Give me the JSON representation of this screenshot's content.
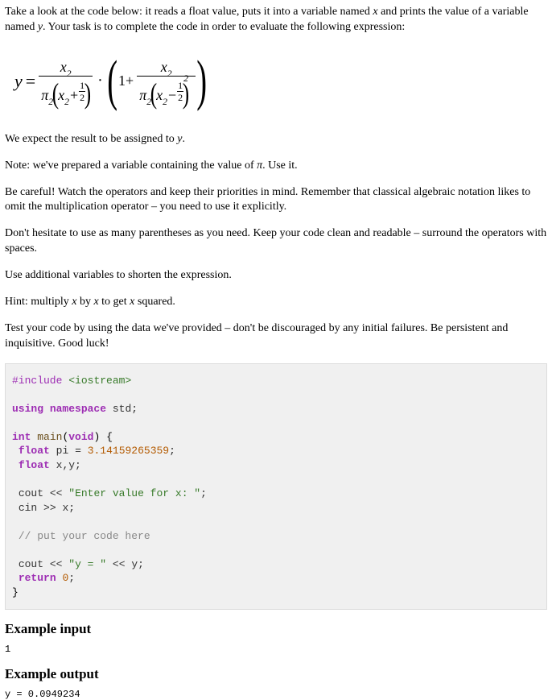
{
  "intro": "Take a look at the code below: it reads a float value, puts it into a variable named ",
  "intro2": " and prints the value of a variable named ",
  "intro3": ". Your task is to complete the code in order to evaluate the following expression:",
  "var_x": "x",
  "var_y": "y",
  "var_pi": "π",
  "expect": "We expect the result to be assigned to ",
  "expect_end": ".",
  "note": "Note: we've prepared a variable containing the value of ",
  "note_end": ". Use it.",
  "careful": "Be careful! Watch the operators and keep their priorities in mind. Remember that classical algebraic notation likes to omit the multiplication operator – you need to use it explicitly.",
  "parens": "Don't hesitate to use as many parentheses as you need. Keep your code clean and readable – surround the operators with spaces.",
  "additional": "Use additional variables to shorten the expression.",
  "hint_a": "Hint: multiply ",
  "hint_b": " by ",
  "hint_c": " to get ",
  "hint_d": " squared.",
  "test": "Test your code by using the data we've provided – don't be discouraged by any initial failures. Be persistent and inquisitive. Good luck!",
  "code": {
    "include": "#include",
    "iostream": "<iostream>",
    "using": "using",
    "namespace": "namespace",
    "std": "std",
    "int": "int",
    "main": "main",
    "void": "void",
    "float": "float",
    "pi": "pi",
    "eq": "=",
    "pival": "3.14159265359",
    "xy": "x,y",
    "cout": "cout",
    "ltlt": "<<",
    "prompt": "\"Enter value for x: \"",
    "cin": "cin",
    "gtgt": ">>",
    "x": "x",
    "comment": "// put your code here",
    "ystr": "\"y = \"",
    "y": "y",
    "return": "return",
    "zero": "0",
    "semi": ";"
  },
  "example_input_h": "Example input",
  "example_input": "1",
  "example_output_h": "Example output",
  "example_output": "y = 0.0949234"
}
